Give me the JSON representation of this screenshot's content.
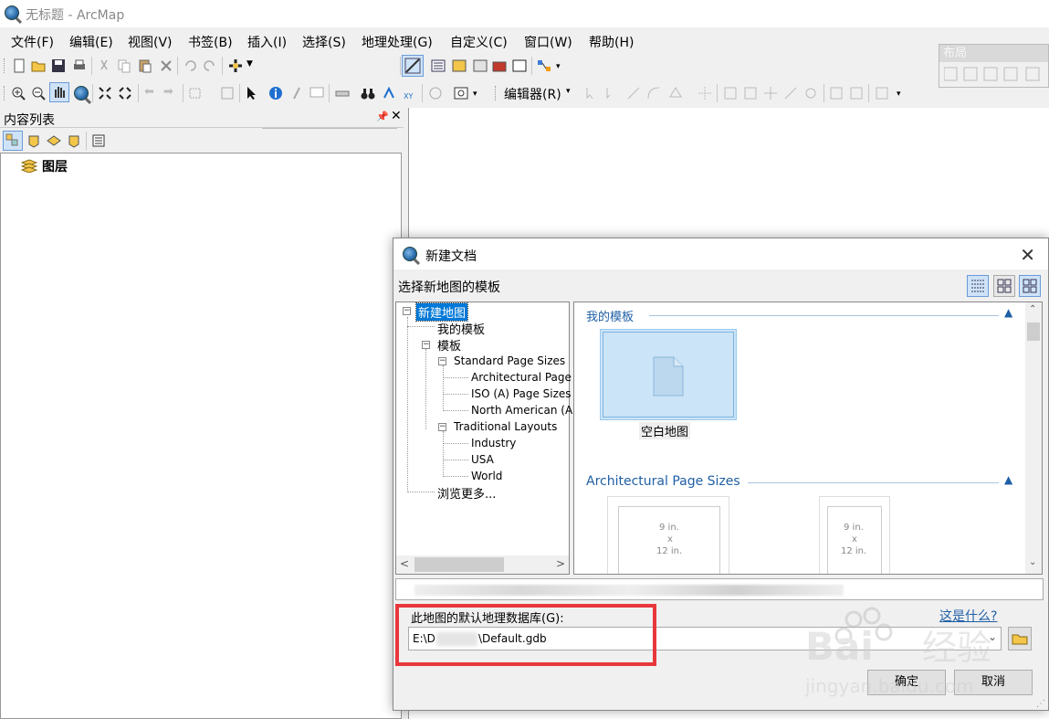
{
  "window": {
    "title": "无标题 - ArcMap"
  },
  "menu": [
    "文件(F)",
    "编辑(E)",
    "视图(V)",
    "书签(B)",
    "插入(I)",
    "选择(S)",
    "地理处理(G)",
    "自定义(C)",
    "窗口(W)",
    "帮助(H)"
  ],
  "toolbar": {
    "scale_value": "",
    "editor_label": "编辑器(R)"
  },
  "layout_toolbar": {
    "title": "布局"
  },
  "toc": {
    "title": "内容列表",
    "pin": "𝟒",
    "close": "✕",
    "root_label": "图层"
  },
  "dialog": {
    "title": "新建文档",
    "subtitle": "选择新地图的模板",
    "close": "✕",
    "tree": {
      "root": "新建地图",
      "my_templates": "我的模板",
      "templates": "模板",
      "standard": "Standard Page Sizes",
      "architectural": "Architectural Page",
      "iso": "ISO (A) Page Sizes",
      "north_american": "North American (A",
      "traditional": "Traditional Layouts",
      "industry": "Industry",
      "usa": "USA",
      "world": "World",
      "browse": "浏览更多..."
    },
    "gallery": {
      "section1": "我的模板",
      "blank_label": "空白地图",
      "section2": "Architectural Page Sizes",
      "page1": {
        "w": "9 in.",
        "x": "x",
        "h": "12 in."
      },
      "page2": {
        "w": "9 in.",
        "x": "x",
        "h": "12 in."
      }
    },
    "gdb_label": "此地图的默认地理数据库(G):",
    "whats_this": "这是什么?",
    "gdb_path_prefix": "E:\\D",
    "gdb_path_suffix": "\\Default.gdb",
    "ok": "确定",
    "cancel": "取消"
  },
  "colors": {
    "accent": "#1f5fa5",
    "highlight": "#0078d7",
    "red_annotation": "#e8373c"
  }
}
